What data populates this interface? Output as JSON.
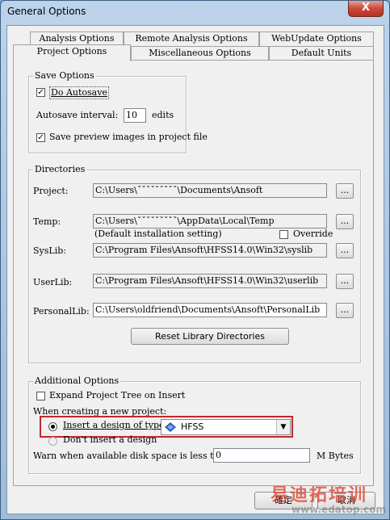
{
  "window": {
    "title": "General Options",
    "close_glyph": "X"
  },
  "tabs": {
    "row_back": [
      "Analysis Options",
      "Remote Analysis Options",
      "WebUpdate Options"
    ],
    "row_front": [
      "Project Options",
      "Miscellaneous Options",
      "Default Units"
    ],
    "active": "Project Options"
  },
  "save_options": {
    "legend": "Save Options",
    "do_autosave": {
      "label": "Do Autosave",
      "checked": true
    },
    "autosave_interval": {
      "label": "Autosave interval:",
      "value": "10",
      "unit": "edits"
    },
    "save_preview": {
      "label": "Save preview images in project file",
      "checked": true
    }
  },
  "directories": {
    "legend": "Directories",
    "project": {
      "label": "Project:",
      "value": "C:\\Users\\ˇˇˇˇˇˇˇˇˇ\\Documents\\Ansoft"
    },
    "temp": {
      "label": "Temp:",
      "value": "C:\\Users\\ˇˇˇˇˇˇˇˇˇ\\AppData\\Local\\Temp",
      "note": "(Default installation setting)",
      "override_label": "Override",
      "override_checked": false
    },
    "syslib": {
      "label": "SysLib:",
      "value": "C:\\Program Files\\Ansoft\\HFSS14.0\\Win32\\syslib"
    },
    "userlib": {
      "label": "UserLib:",
      "value": "C:\\Program Files\\Ansoft\\HFSS14.0\\Win32\\userlib"
    },
    "personallib": {
      "label": "PersonalLib:",
      "value": "C:\\Users\\oldfriend\\Documents\\Ansoft\\PersonalLib"
    },
    "browse_label": "...",
    "reset_button": "Reset Library Directories"
  },
  "additional_options": {
    "legend": "Additional Options",
    "expand_tree": {
      "label": "Expand Project Tree on Insert",
      "checked": false
    },
    "new_project_label": "When creating a new project:",
    "insert_design": {
      "label": "Insert a design of type:",
      "selected": true
    },
    "design_type": {
      "value": "HFSS",
      "icon": "hfss-icon"
    },
    "dont_insert": {
      "label": "Don't insert a design",
      "selected": false
    },
    "disk_warn": {
      "label": "Warn when available disk space is less than",
      "value": "0",
      "unit": "M Bytes"
    }
  },
  "footer": {
    "ok": "確定",
    "cancel": "取消"
  },
  "watermark": {
    "brand": "易迪拓培训",
    "url": "www.edatop.com"
  },
  "colors": {
    "highlight": "#c1272d",
    "close": "#c9493b",
    "watermark": "#e04a3a"
  }
}
